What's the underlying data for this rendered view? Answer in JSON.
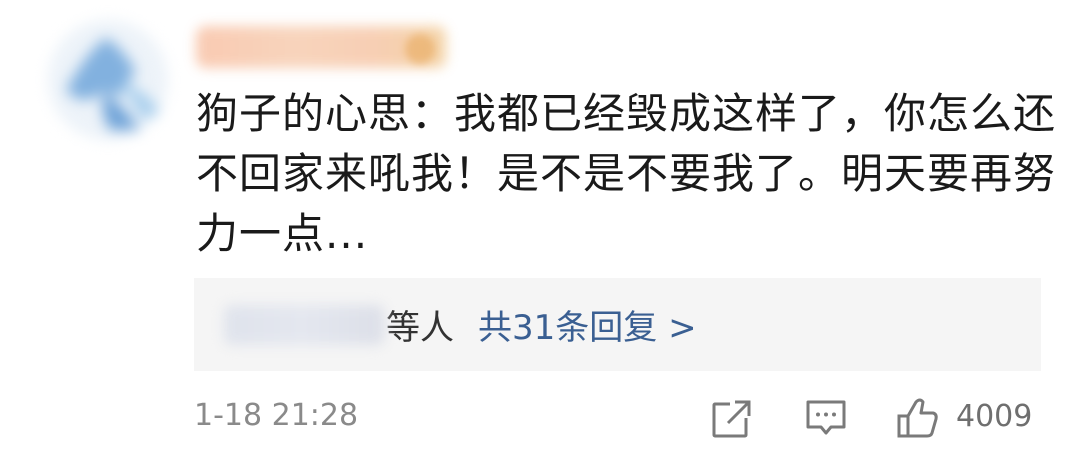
{
  "comment": {
    "text": "狗子的心思：我都已经毁成这样了，你怎么还不回家来吼我！是不是不要我了。明天要再努力一点...",
    "reply_suffix": "等人",
    "reply_link": "共31条回复 >",
    "timestamp": "1-18 21:28",
    "like_count": "4009"
  },
  "icons": {
    "share": "share-icon",
    "reply": "comment-icon",
    "like": "thumb-up-icon"
  },
  "colors": {
    "text": "#1a1a1a",
    "link": "#3a5f92",
    "muted": "#8a8a8a",
    "reply_bg": "#f5f5f5"
  }
}
